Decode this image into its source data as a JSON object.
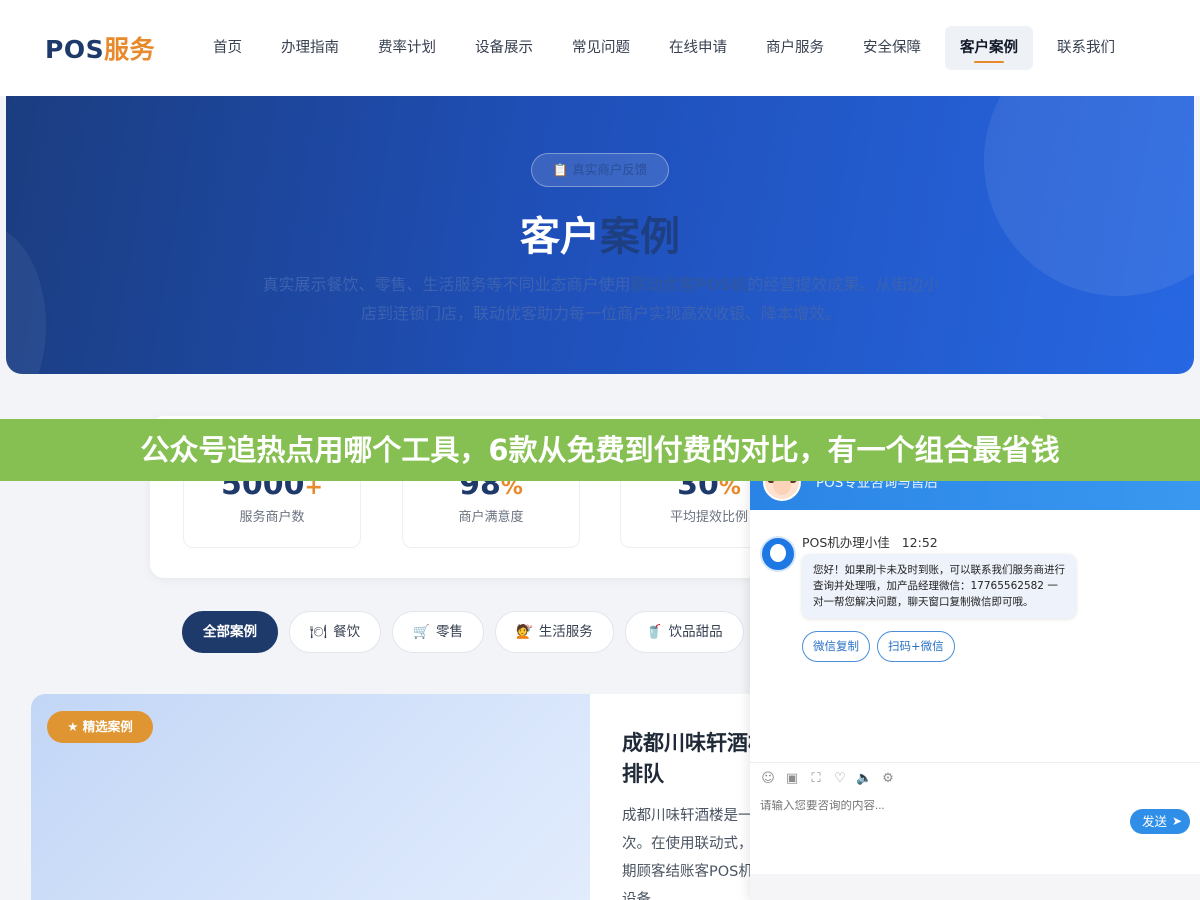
{
  "header": {
    "logo_part1": "POS",
    "logo_part2": "服务",
    "nav": [
      {
        "label": "首页"
      },
      {
        "label": "办理指南"
      },
      {
        "label": "费率计划"
      },
      {
        "label": "设备展示"
      },
      {
        "label": "常见问题"
      },
      {
        "label": "在线申请"
      },
      {
        "label": "商户服务"
      },
      {
        "label": "安全保障"
      },
      {
        "label": "客户案例",
        "active": true
      },
      {
        "label": "联系我们"
      }
    ]
  },
  "hero": {
    "badge": "📋 真实商户反馈",
    "title_part1": "客户",
    "title_part2": "案例",
    "desc_part1": "真实展示餐饮、零售、生活服务等不同业态商户使用",
    "desc_bold": "联动优客POS机",
    "desc_part2": "的经营提效成果。从街边小店到连锁门店，联动优客助力每一位商户实现高效收银、降本增效。"
  },
  "stats": [
    {
      "value": "5000",
      "suffix": "+",
      "label": "服务商户数"
    },
    {
      "value": "98",
      "suffix": "%",
      "label": "商户满意度"
    },
    {
      "value": "30",
      "suffix": "%",
      "label": "平均提效比例"
    }
  ],
  "filters": [
    {
      "label": "全部案例",
      "icon": "",
      "active": true
    },
    {
      "label": "餐饮",
      "icon": "🍽"
    },
    {
      "label": "零售",
      "icon": "🛒"
    },
    {
      "label": "生活服务",
      "icon": "💇"
    },
    {
      "label": "饮品甜品",
      "icon": "🥤"
    }
  ],
  "featured_case": {
    "tag": "★ 精选案例",
    "title": "成都川味轩酒楼零排队",
    "text": "成都川味轩酒楼是一人次。在使用联动式，高峰期顾客结账客POS机后，设备"
  },
  "banner": {
    "text": "公众号追热点用哪个工具，6款从免费到付费的对比，有一个组合最省钱"
  },
  "chat": {
    "title": "POS专业咨询与售后",
    "min_symbol": "—",
    "sender": "POS机办理小佳",
    "time": "12:52",
    "message": "您好！如果刷卡未及时到账，可以联系我们服务商进行查询并处理哦，加产品经理微信：17765562582 一对一帮您解决问题，聊天窗口复制微信即可哦。",
    "buttons": [
      "微信复制",
      "扫码+微信"
    ],
    "tools": [
      "☺",
      "▣",
      "⛶",
      "♡",
      "🔈",
      "⚙"
    ],
    "input_placeholder": "请输入您要咨询的内容...",
    "send_label": "发送",
    "send_arrow": "➤"
  }
}
